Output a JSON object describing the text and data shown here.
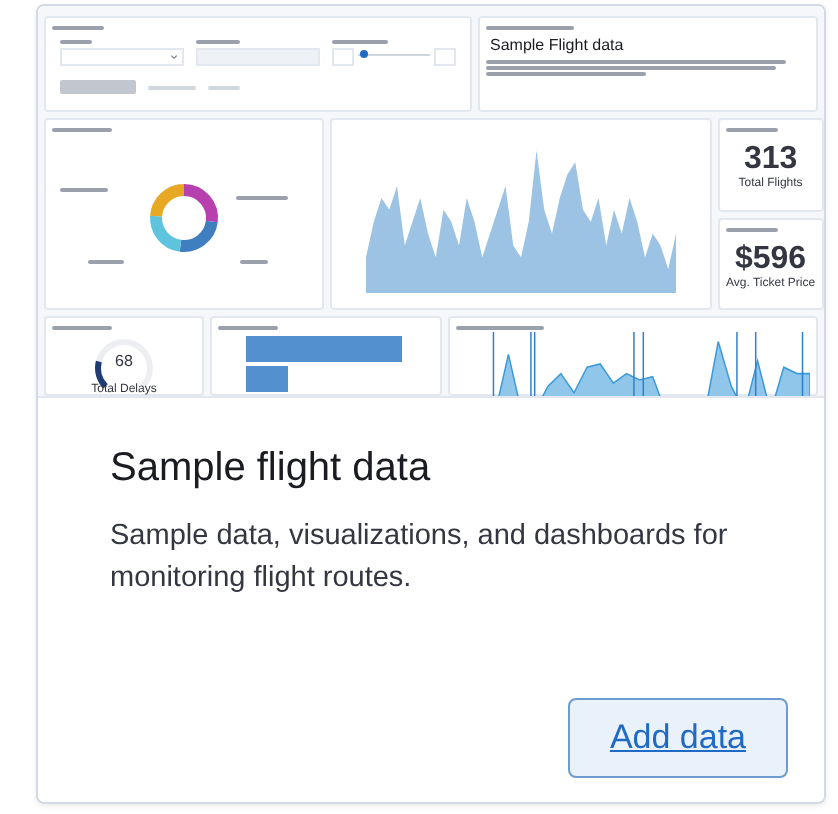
{
  "preview": {
    "price_slider": {
      "level": 0.08
    },
    "markdown_heading": "Sample Flight data",
    "metrics": [
      {
        "value": "313",
        "label": "Total Flights"
      },
      {
        "value": "$596",
        "label": "Avg. Ticket Price"
      }
    ],
    "delays_gauge": {
      "level": 0.22,
      "value": "68",
      "label": "Total Delays"
    }
  },
  "card": {
    "title": "Sample flight data",
    "description": "Sample data, visualizations, and dashboards for monitoring flight routes.",
    "action": "Add data"
  }
}
